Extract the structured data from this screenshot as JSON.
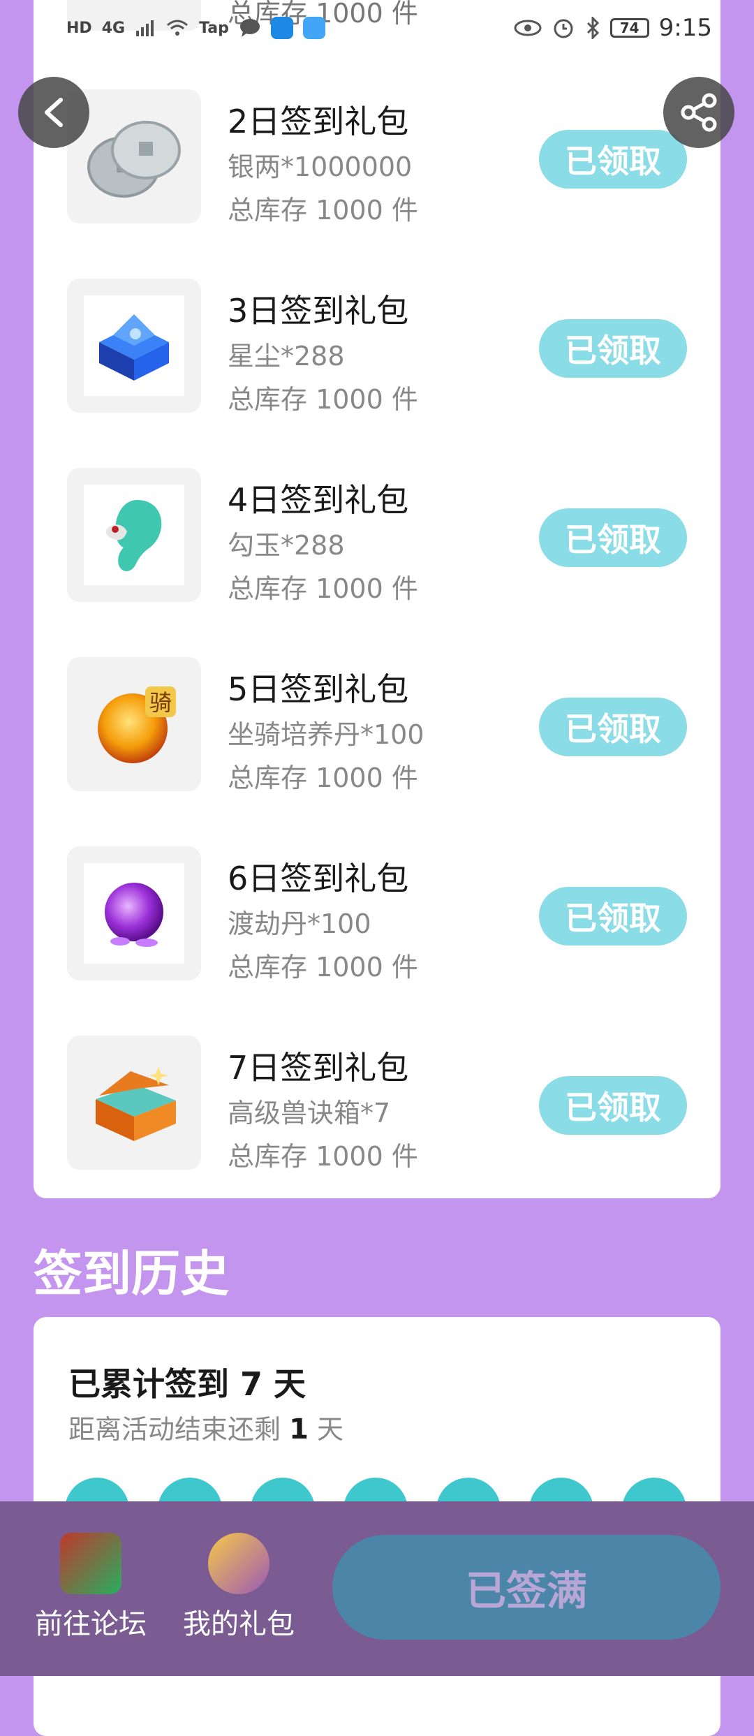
{
  "status_bar": {
    "left_badges": [
      "HD",
      "4G",
      "Tap"
    ],
    "battery": "74",
    "time": "9:15"
  },
  "top_partial": {
    "stock": "总库存 1000 件"
  },
  "rewards": [
    {
      "title": "2日签到礼包",
      "desc": "银两*1000000",
      "stock": "总库存 1000 件",
      "button": "已领取",
      "icon": "silver-coins-icon"
    },
    {
      "title": "3日签到礼包",
      "desc": "星尘*288",
      "stock": "总库存 1000 件",
      "button": "已领取",
      "icon": "blue-chest-icon"
    },
    {
      "title": "4日签到礼包",
      "desc": "勾玉*288",
      "stock": "总库存 1000 件",
      "button": "已领取",
      "icon": "magatama-icon"
    },
    {
      "title": "5日签到礼包",
      "desc": "坐骑培养丹*100",
      "stock": "总库存 1000 件",
      "button": "已领取",
      "icon": "mount-pill-icon"
    },
    {
      "title": "6日签到礼包",
      "desc": "渡劫丹*100",
      "stock": "总库存 1000 件",
      "button": "已领取",
      "icon": "purple-orb-icon"
    },
    {
      "title": "7日签到礼包",
      "desc": "高级兽诀箱*7",
      "stock": "总库存 1000 件",
      "button": "已领取",
      "icon": "treasure-chest-icon"
    }
  ],
  "history": {
    "title": "签到历史",
    "count_text": "已累计签到 7 天",
    "remain_prefix": "距离活动结束还剩",
    "remain_days": "1",
    "remain_suffix": "天"
  },
  "bottom_nav": {
    "forum": "前往论坛",
    "gifts": "我的礼包",
    "signed_button": "已签满"
  },
  "colors": {
    "background": "#C495EE",
    "claim_button": "#8ADCE6",
    "bottom_bar": "#7A5C92",
    "signed_button": "#4B86A9"
  }
}
